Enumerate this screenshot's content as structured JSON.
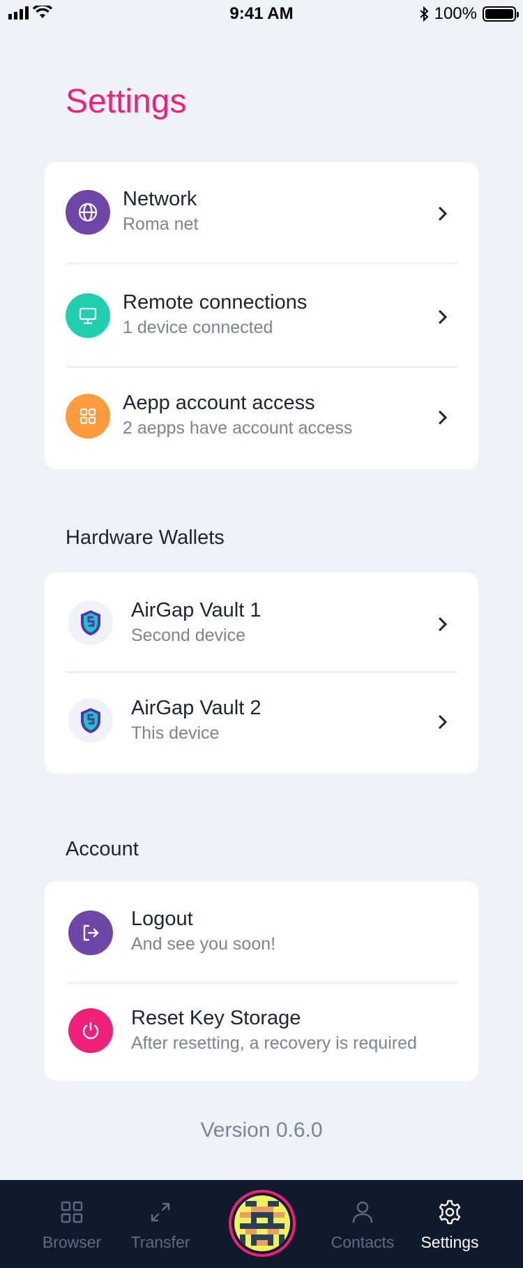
{
  "status_bar": {
    "time": "9:41 AM",
    "battery": "100%",
    "icons": [
      "signal-icon",
      "wifi-icon",
      "bluetooth-icon",
      "battery-icon"
    ]
  },
  "page_title": "Settings",
  "main_card": {
    "items": [
      {
        "title": "Network",
        "subtitle": "Roma net",
        "icon": "globe-icon",
        "color": "#6d46a8"
      },
      {
        "title": "Remote connections",
        "subtitle": "1 device connected",
        "icon": "monitor-icon",
        "color": "#1fcfae"
      },
      {
        "title": "Aepp account access",
        "subtitle": "2 aepps have account access",
        "icon": "grid-icon",
        "color": "#ff9b3d"
      }
    ]
  },
  "hardware": {
    "heading": "Hardware Wallets",
    "items": [
      {
        "title": "AirGap Vault 1",
        "subtitle": "Second device",
        "icon": "airgap-shield-icon"
      },
      {
        "title": "AirGap Vault 2",
        "subtitle": "This device",
        "icon": "airgap-shield-icon"
      }
    ]
  },
  "account": {
    "heading": "Account",
    "items": [
      {
        "title": "Logout",
        "subtitle": "And see you soon!",
        "icon": "logout-icon",
        "color": "#6d46a8"
      },
      {
        "title": "Reset Key Storage",
        "subtitle": "After resetting, a recovery is required",
        "icon": "power-icon",
        "color": "#ef1f7a"
      }
    ]
  },
  "version": "Version 0.6.0",
  "tab_bar": {
    "tabs": [
      {
        "label": "Browser",
        "icon": "browser-grid-icon",
        "active": false
      },
      {
        "label": "Transfer",
        "icon": "transfer-arrows-icon",
        "active": false
      },
      {
        "label": "",
        "icon": "account-avatar",
        "active": false
      },
      {
        "label": "Contacts",
        "icon": "person-icon",
        "active": false
      },
      {
        "label": "Settings",
        "icon": "gear-icon",
        "active": true
      }
    ]
  },
  "colors": {
    "accent": "#ef1f7a",
    "background": "#eef2f7",
    "tab_bar_bg": "#0f1a2f"
  }
}
